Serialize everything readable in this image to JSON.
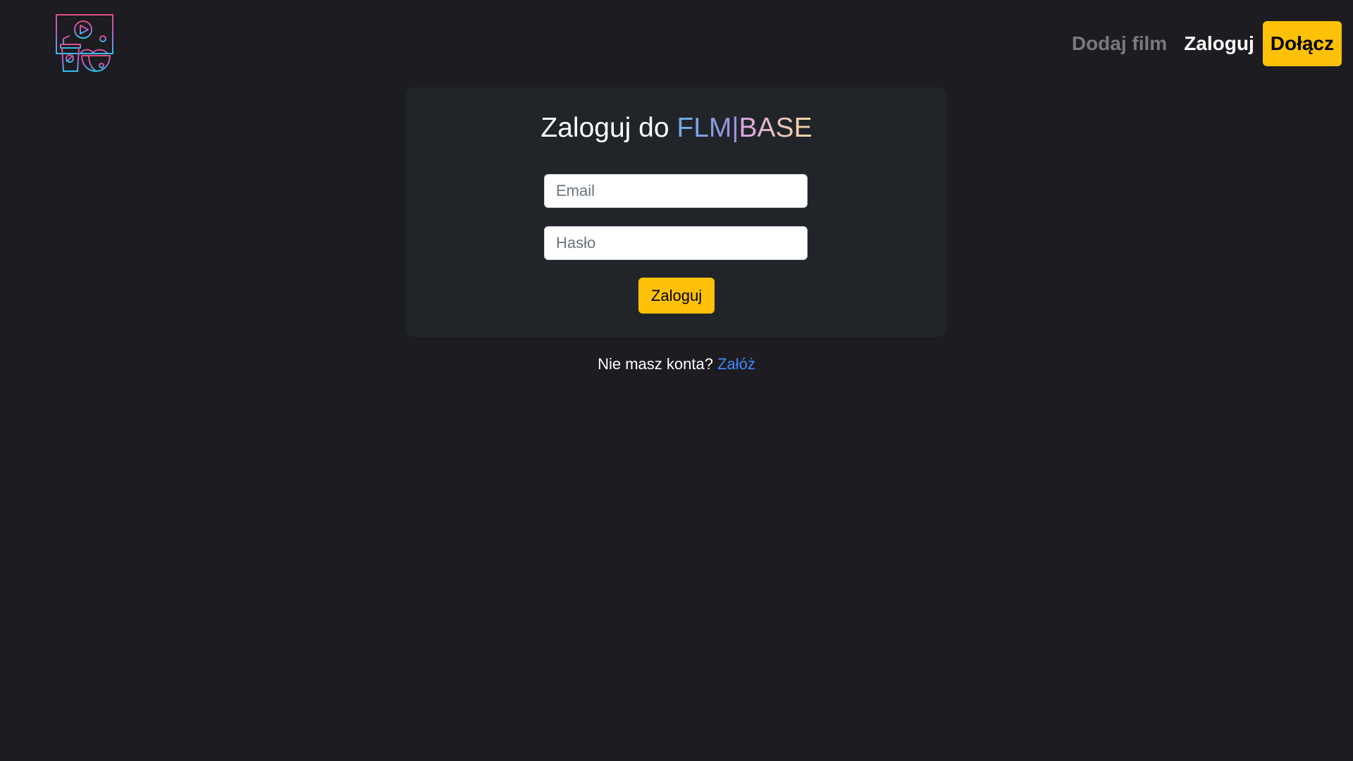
{
  "header": {
    "logo": "cinema-logo-icon",
    "nav": {
      "add_film": "Dodaj film",
      "login": "Zaloguj",
      "join": "Dołącz"
    }
  },
  "login_card": {
    "title_prefix": "Zaloguj do",
    "brand_part_1": "FLM|",
    "brand_part_2": "BASE",
    "email_placeholder": "Email",
    "password_placeholder": "Hasło",
    "submit_label": "Zaloguj"
  },
  "signup": {
    "prompt": "Nie masz konta?",
    "link_label": "Załóż"
  },
  "colors": {
    "background": "#1c1c21",
    "card": "#212529",
    "accent": "#ffc107",
    "link": "#3d8bfd"
  }
}
